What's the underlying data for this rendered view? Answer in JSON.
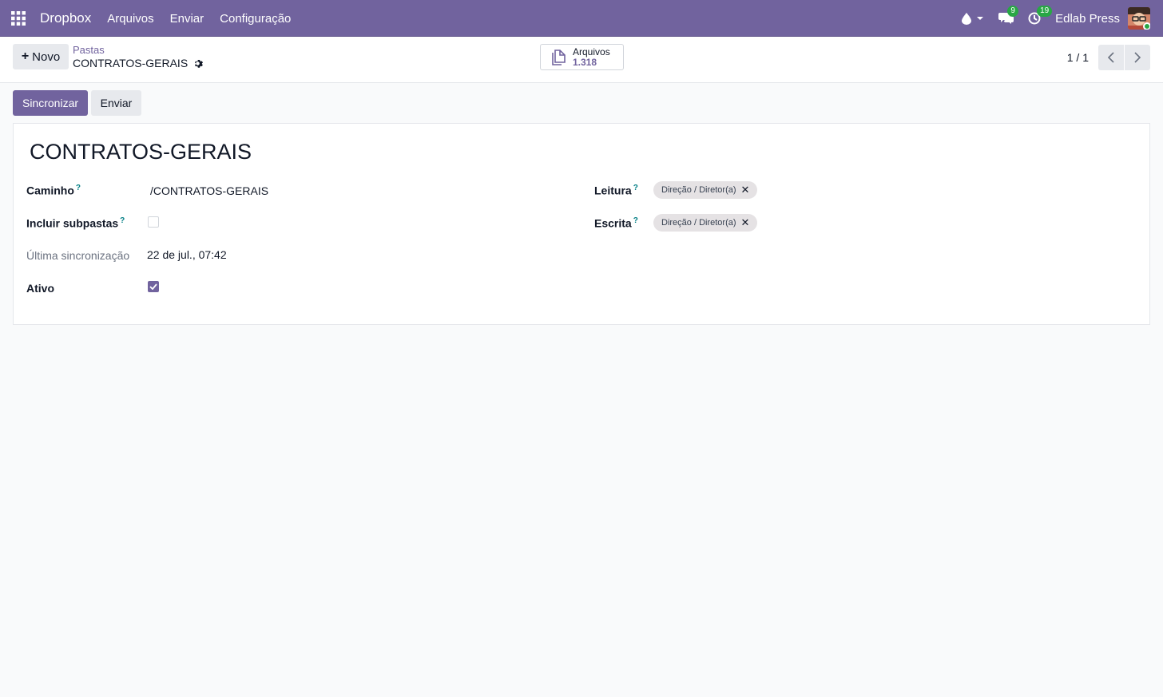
{
  "navbar": {
    "brand": "Dropbox",
    "menu": [
      "Arquivos",
      "Enviar",
      "Configuração"
    ],
    "messages_count": "9",
    "activities_count": "19",
    "company": "Edlab Press"
  },
  "control": {
    "new_label": "Novo",
    "breadcrumb_parent": "Pastas",
    "breadcrumb_current": "CONTRATOS-GERAIS",
    "smart_button_label": "Arquivos",
    "smart_button_value": "1.318",
    "pager": "1 / 1"
  },
  "status": {
    "sync_label": "Sincronizar",
    "send_label": "Enviar"
  },
  "form": {
    "title": "CONTRATOS-GERAIS",
    "path_label": "Caminho",
    "path_value": "/CONTRATOS-GERAIS",
    "subfolders_label": "Incluir subpastas",
    "subfolders_checked": false,
    "last_sync_label": "Última sincronização",
    "last_sync_value": "22 de jul., 07:42",
    "active_label": "Ativo",
    "active_checked": true,
    "read_label": "Leitura",
    "read_tag": "Direção / Diretor(a)",
    "write_label": "Escrita",
    "write_tag": "Direção / Diretor(a)",
    "help_mark": "?"
  },
  "colors": {
    "brand": "#71639e",
    "help": "#017e84",
    "badge": "#28a745"
  }
}
